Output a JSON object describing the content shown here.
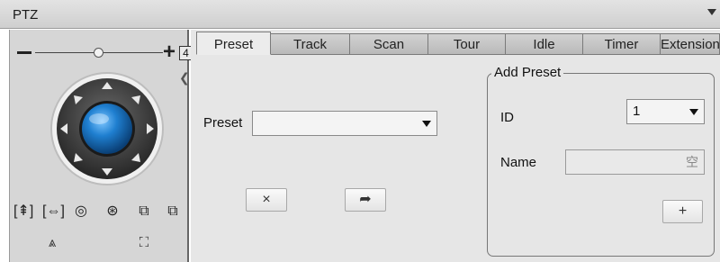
{
  "window": {
    "title": "PTZ"
  },
  "zoom": {
    "minus_label": "−",
    "plus_label": "+",
    "speed_value": "4",
    "level_fraction": 0.6
  },
  "joystick": {
    "center_color": "#1f7fd0",
    "ring_color": "#3a3a3a"
  },
  "controls": {
    "row1": [
      "focus-near-icon",
      "focus-far-icon",
      "iris-open-icon",
      "iris-close-icon",
      "window-icon",
      "window-alt-icon"
    ],
    "row1_glyphs": [
      "[⇞]",
      "[⇔]",
      "◎",
      "⊛",
      "⧉",
      "⧉"
    ],
    "row2_glyphs": [
      "⩓",
      "⛶"
    ]
  },
  "tabs": [
    {
      "label": "Preset",
      "active": true
    },
    {
      "label": "Track",
      "active": false
    },
    {
      "label": "Scan",
      "active": false
    },
    {
      "label": "Tour",
      "active": false
    },
    {
      "label": "Idle",
      "active": false
    },
    {
      "label": "Timer",
      "active": false
    },
    {
      "label": "Extension",
      "active": false
    }
  ],
  "preset": {
    "label": "Preset",
    "selected": "",
    "delete_glyph": "×",
    "goto_glyph": "➦"
  },
  "add_preset": {
    "title": "Add Preset",
    "id_label": "ID",
    "id_value": "1",
    "name_label": "Name",
    "name_value": "空",
    "add_glyph": "+"
  }
}
